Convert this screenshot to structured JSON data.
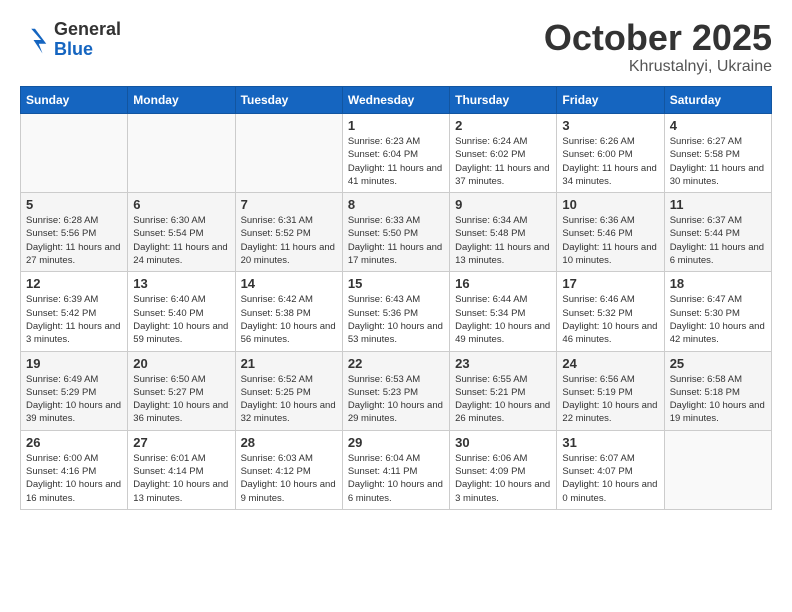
{
  "header": {
    "logo": {
      "line1": "General",
      "line2": "Blue"
    },
    "title": "October 2025",
    "subtitle": "Khrustalnyi, Ukraine"
  },
  "weekdays": [
    "Sunday",
    "Monday",
    "Tuesday",
    "Wednesday",
    "Thursday",
    "Friday",
    "Saturday"
  ],
  "weeks": [
    [
      {
        "day": "",
        "sunrise": "",
        "sunset": "",
        "daylight": ""
      },
      {
        "day": "",
        "sunrise": "",
        "sunset": "",
        "daylight": ""
      },
      {
        "day": "",
        "sunrise": "",
        "sunset": "",
        "daylight": ""
      },
      {
        "day": "1",
        "sunrise": "Sunrise: 6:23 AM",
        "sunset": "Sunset: 6:04 PM",
        "daylight": "Daylight: 11 hours and 41 minutes."
      },
      {
        "day": "2",
        "sunrise": "Sunrise: 6:24 AM",
        "sunset": "Sunset: 6:02 PM",
        "daylight": "Daylight: 11 hours and 37 minutes."
      },
      {
        "day": "3",
        "sunrise": "Sunrise: 6:26 AM",
        "sunset": "Sunset: 6:00 PM",
        "daylight": "Daylight: 11 hours and 34 minutes."
      },
      {
        "day": "4",
        "sunrise": "Sunrise: 6:27 AM",
        "sunset": "Sunset: 5:58 PM",
        "daylight": "Daylight: 11 hours and 30 minutes."
      }
    ],
    [
      {
        "day": "5",
        "sunrise": "Sunrise: 6:28 AM",
        "sunset": "Sunset: 5:56 PM",
        "daylight": "Daylight: 11 hours and 27 minutes."
      },
      {
        "day": "6",
        "sunrise": "Sunrise: 6:30 AM",
        "sunset": "Sunset: 5:54 PM",
        "daylight": "Daylight: 11 hours and 24 minutes."
      },
      {
        "day": "7",
        "sunrise": "Sunrise: 6:31 AM",
        "sunset": "Sunset: 5:52 PM",
        "daylight": "Daylight: 11 hours and 20 minutes."
      },
      {
        "day": "8",
        "sunrise": "Sunrise: 6:33 AM",
        "sunset": "Sunset: 5:50 PM",
        "daylight": "Daylight: 11 hours and 17 minutes."
      },
      {
        "day": "9",
        "sunrise": "Sunrise: 6:34 AM",
        "sunset": "Sunset: 5:48 PM",
        "daylight": "Daylight: 11 hours and 13 minutes."
      },
      {
        "day": "10",
        "sunrise": "Sunrise: 6:36 AM",
        "sunset": "Sunset: 5:46 PM",
        "daylight": "Daylight: 11 hours and 10 minutes."
      },
      {
        "day": "11",
        "sunrise": "Sunrise: 6:37 AM",
        "sunset": "Sunset: 5:44 PM",
        "daylight": "Daylight: 11 hours and 6 minutes."
      }
    ],
    [
      {
        "day": "12",
        "sunrise": "Sunrise: 6:39 AM",
        "sunset": "Sunset: 5:42 PM",
        "daylight": "Daylight: 11 hours and 3 minutes."
      },
      {
        "day": "13",
        "sunrise": "Sunrise: 6:40 AM",
        "sunset": "Sunset: 5:40 PM",
        "daylight": "Daylight: 10 hours and 59 minutes."
      },
      {
        "day": "14",
        "sunrise": "Sunrise: 6:42 AM",
        "sunset": "Sunset: 5:38 PM",
        "daylight": "Daylight: 10 hours and 56 minutes."
      },
      {
        "day": "15",
        "sunrise": "Sunrise: 6:43 AM",
        "sunset": "Sunset: 5:36 PM",
        "daylight": "Daylight: 10 hours and 53 minutes."
      },
      {
        "day": "16",
        "sunrise": "Sunrise: 6:44 AM",
        "sunset": "Sunset: 5:34 PM",
        "daylight": "Daylight: 10 hours and 49 minutes."
      },
      {
        "day": "17",
        "sunrise": "Sunrise: 6:46 AM",
        "sunset": "Sunset: 5:32 PM",
        "daylight": "Daylight: 10 hours and 46 minutes."
      },
      {
        "day": "18",
        "sunrise": "Sunrise: 6:47 AM",
        "sunset": "Sunset: 5:30 PM",
        "daylight": "Daylight: 10 hours and 42 minutes."
      }
    ],
    [
      {
        "day": "19",
        "sunrise": "Sunrise: 6:49 AM",
        "sunset": "Sunset: 5:29 PM",
        "daylight": "Daylight: 10 hours and 39 minutes."
      },
      {
        "day": "20",
        "sunrise": "Sunrise: 6:50 AM",
        "sunset": "Sunset: 5:27 PM",
        "daylight": "Daylight: 10 hours and 36 minutes."
      },
      {
        "day": "21",
        "sunrise": "Sunrise: 6:52 AM",
        "sunset": "Sunset: 5:25 PM",
        "daylight": "Daylight: 10 hours and 32 minutes."
      },
      {
        "day": "22",
        "sunrise": "Sunrise: 6:53 AM",
        "sunset": "Sunset: 5:23 PM",
        "daylight": "Daylight: 10 hours and 29 minutes."
      },
      {
        "day": "23",
        "sunrise": "Sunrise: 6:55 AM",
        "sunset": "Sunset: 5:21 PM",
        "daylight": "Daylight: 10 hours and 26 minutes."
      },
      {
        "day": "24",
        "sunrise": "Sunrise: 6:56 AM",
        "sunset": "Sunset: 5:19 PM",
        "daylight": "Daylight: 10 hours and 22 minutes."
      },
      {
        "day": "25",
        "sunrise": "Sunrise: 6:58 AM",
        "sunset": "Sunset: 5:18 PM",
        "daylight": "Daylight: 10 hours and 19 minutes."
      }
    ],
    [
      {
        "day": "26",
        "sunrise": "Sunrise: 6:00 AM",
        "sunset": "Sunset: 4:16 PM",
        "daylight": "Daylight: 10 hours and 16 minutes."
      },
      {
        "day": "27",
        "sunrise": "Sunrise: 6:01 AM",
        "sunset": "Sunset: 4:14 PM",
        "daylight": "Daylight: 10 hours and 13 minutes."
      },
      {
        "day": "28",
        "sunrise": "Sunrise: 6:03 AM",
        "sunset": "Sunset: 4:12 PM",
        "daylight": "Daylight: 10 hours and 9 minutes."
      },
      {
        "day": "29",
        "sunrise": "Sunrise: 6:04 AM",
        "sunset": "Sunset: 4:11 PM",
        "daylight": "Daylight: 10 hours and 6 minutes."
      },
      {
        "day": "30",
        "sunrise": "Sunrise: 6:06 AM",
        "sunset": "Sunset: 4:09 PM",
        "daylight": "Daylight: 10 hours and 3 minutes."
      },
      {
        "day": "31",
        "sunrise": "Sunrise: 6:07 AM",
        "sunset": "Sunset: 4:07 PM",
        "daylight": "Daylight: 10 hours and 0 minutes."
      },
      {
        "day": "",
        "sunrise": "",
        "sunset": "",
        "daylight": ""
      }
    ]
  ]
}
